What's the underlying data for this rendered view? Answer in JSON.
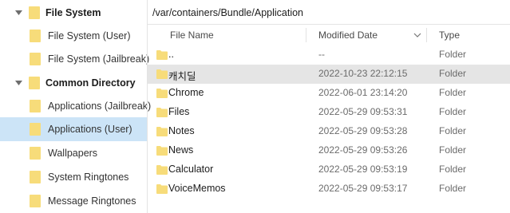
{
  "colors": {
    "folder": "#f7dc7a",
    "selection": "#cce4f7",
    "row_hover": "#e5e5e5"
  },
  "sidebar": {
    "items": [
      {
        "label": "File System",
        "bold": true,
        "expanded": true,
        "icon": "folder-icon"
      },
      {
        "label": "File System (User)",
        "icon": "folder-icon"
      },
      {
        "label": "File System (Jailbreak)",
        "icon": "folder-icon"
      },
      {
        "label": "Common Directory",
        "bold": true,
        "expanded": true,
        "icon": "folder-icon"
      },
      {
        "label": "Applications (Jailbreak)",
        "icon": "folder-icon"
      },
      {
        "label": "Applications (User)",
        "icon": "folder-icon",
        "selected": true
      },
      {
        "label": "Wallpapers",
        "icon": "folder-icon"
      },
      {
        "label": "System Ringtones",
        "icon": "folder-icon"
      },
      {
        "label": "Message Ringtones",
        "icon": "folder-icon"
      }
    ]
  },
  "path": "/var/containers/Bundle/Application",
  "columns": {
    "name": "File Name",
    "modified": "Modified Date",
    "type": "Type",
    "sort_icon": "chevron-down-icon"
  },
  "files": [
    {
      "name": "..",
      "modified": "--",
      "type": "Folder"
    },
    {
      "name": "캐치딜",
      "modified": "2022-10-23 22:12:15",
      "type": "Folder",
      "hover": true
    },
    {
      "name": "Chrome",
      "modified": "2022-06-01 23:14:20",
      "type": "Folder"
    },
    {
      "name": "Files",
      "modified": "2022-05-29 09:53:31",
      "type": "Folder"
    },
    {
      "name": "Notes",
      "modified": "2022-05-29 09:53:28",
      "type": "Folder"
    },
    {
      "name": "News",
      "modified": "2022-05-29 09:53:26",
      "type": "Folder"
    },
    {
      "name": "Calculator",
      "modified": "2022-05-29 09:53:19",
      "type": "Folder"
    },
    {
      "name": "VoiceMemos",
      "modified": "2022-05-29 09:53:17",
      "type": "Folder"
    }
  ]
}
